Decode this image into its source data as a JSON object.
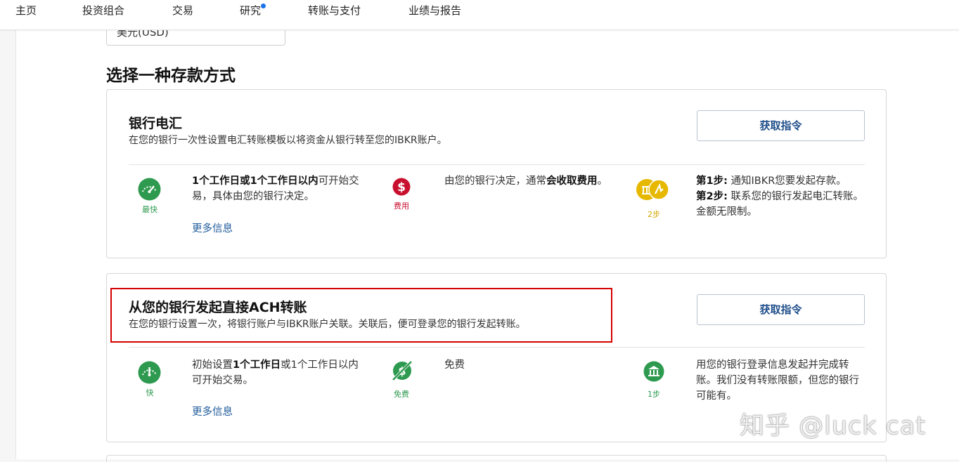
{
  "nav": {
    "items": [
      "主页",
      "投资组合",
      "交易",
      "研究",
      "转账与支付",
      "业绩与报告"
    ]
  },
  "currency_select": {
    "value": "美元(USD)"
  },
  "section_title": "选择一种存款方式",
  "cards": [
    {
      "title": "银行电汇",
      "description": "在您的银行一次性设置电汇转账模板以将资金从银行转至您的IBKR账户。",
      "button": "获取指令",
      "speed": {
        "caption": "最快",
        "bold1": "1个工作日或1个工作日以内",
        "text1": "可开始交易，具体由您的银行决定。"
      },
      "fee": {
        "caption": "费用",
        "text1": "由您的银行决定，通常",
        "bold1": "会收取费用",
        "text2": "。"
      },
      "steps": {
        "caption": "2步",
        "step1_label": "第1步:",
        "step1_text": " 通知IBKR您要发起存款。",
        "step2_label": "第2步:",
        "step2_text": " 联系您的银行发起电汇转账。金额无限制。"
      },
      "more_link": "更多信息"
    },
    {
      "title": "从您的银行发起直接ACH转账",
      "description": "在您的银行设置一次，将银行账户与IBKR账户关联。关联后，便可登录您的银行发起转账。",
      "button": "获取指令",
      "speed": {
        "caption": "快",
        "text0": "初始设置",
        "bold1": "1个工作日",
        "text1": "或1个工作日以内可开始交易。"
      },
      "fee": {
        "caption": "免费",
        "text1": "免费"
      },
      "steps": {
        "caption": "1步",
        "text": "用您的银行登录信息发起并完成转账。我们没有转账限额，但您的银行可能有。"
      },
      "more_link": "更多信息"
    }
  ],
  "colors": {
    "accent_green": "#2e9a4f",
    "fee_red": "#c8102e",
    "gold": "#e6b800",
    "link_blue": "#1f5a9a",
    "highlight_red": "#d40000"
  },
  "watermark": "知乎 @luck cat"
}
